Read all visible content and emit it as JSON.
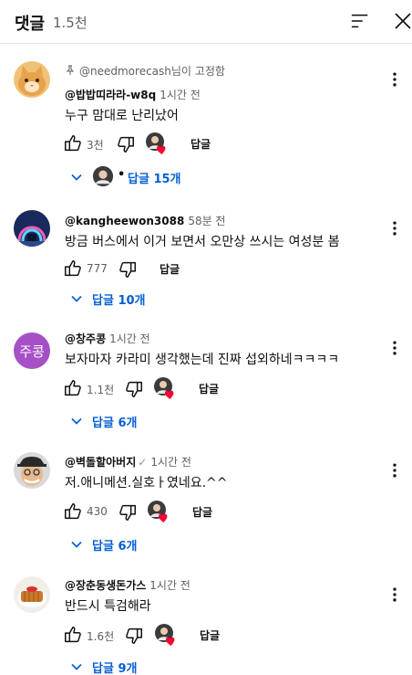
{
  "header": {
    "title": "댓글",
    "count": "1.5천"
  },
  "labels": {
    "reply_button": "답글"
  },
  "comments": [
    {
      "pinned_text": "@needmorecash님이 고정함",
      "author": "@밥밥띠라라-w8q",
      "time": "1시간 전",
      "text": "누구 맘대로 난리났어",
      "likes": "3천",
      "creator_hearted": true,
      "replies": "답글 15개",
      "avatar": "cat-photo"
    },
    {
      "author": "@kangheewon3088",
      "time": "58분 전",
      "text": "방금 버스에서 이거 보면서 오만상 쓰시는 여성분 봄",
      "likes": "777",
      "creator_hearted": false,
      "replies": "답글 10개",
      "avatar": "blue-gate-photo"
    },
    {
      "author": "@창주콩",
      "time": "1시간 전",
      "text": "보자마자 카라미 생각했는데 진짜 섭외하네ㅋㅋㅋㅋ",
      "likes": "1.1천",
      "creator_hearted": true,
      "replies": "답글 6개",
      "avatar_letters": "주콩",
      "avatar_color": "#a650c8"
    },
    {
      "author": "@벽돌할아버지",
      "verified_mark": "✓",
      "time": "1시간 전",
      "text": "저.애니메션.실호ㅏ였네요.^^",
      "likes": "430",
      "creator_hearted": true,
      "replies": "답글 6개",
      "avatar": "old-man-cartoon"
    },
    {
      "author": "@장춘동생돈가스",
      "time": "1시간 전",
      "text": "반드시 특검해라",
      "likes": "1.6천",
      "creator_hearted": true,
      "replies": "답글 9개",
      "avatar": "pork-cutlet-photo"
    }
  ],
  "colors": {
    "link_blue": "#065fd4",
    "muted_text": "#606060",
    "heart_red": "#ff0033"
  }
}
